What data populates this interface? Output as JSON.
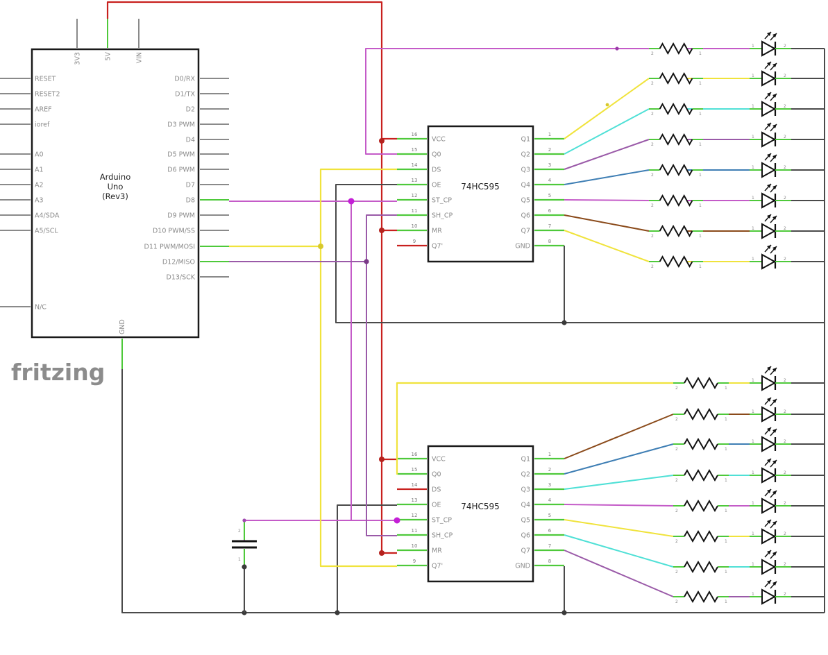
{
  "logo": "fritzing",
  "arduino": {
    "title_lines": [
      "Arduino",
      "Uno",
      "(Rev3)"
    ],
    "top_pins": [
      "3V3",
      "5V",
      "VIN"
    ],
    "left_pins": [
      "RESET",
      "RESET2",
      "AREF",
      "ioref",
      "A0",
      "A1",
      "A2",
      "A3",
      "A4/SDA",
      "A5/SCL",
      "N/C"
    ],
    "right_pins": [
      "D0/RX",
      "D1/TX",
      "D2",
      "D3 PWM",
      "D4",
      "D5 PWM",
      "D6 PWM",
      "D7",
      "D8",
      "D9 PWM",
      "D10 PWM/SS",
      "D11 PWM/MOSI",
      "D12/MISO",
      "D13/SCK"
    ],
    "bottom_pin": "GND"
  },
  "chips": [
    {
      "name": "74HC595",
      "left_pins": [
        {
          "num": "16",
          "label": "VCC"
        },
        {
          "num": "15",
          "label": "Q0"
        },
        {
          "num": "14",
          "label": "DS"
        },
        {
          "num": "13",
          "label": "OE"
        },
        {
          "num": "12",
          "label": "ST_CP"
        },
        {
          "num": "11",
          "label": "SH_CP"
        },
        {
          "num": "10",
          "label": "MR"
        },
        {
          "num": "9",
          "label": "Q7'"
        }
      ],
      "right_pins": [
        {
          "num": "1",
          "label": "Q1"
        },
        {
          "num": "2",
          "label": "Q2"
        },
        {
          "num": "3",
          "label": "Q3"
        },
        {
          "num": "4",
          "label": "Q4"
        },
        {
          "num": "5",
          "label": "Q5"
        },
        {
          "num": "6",
          "label": "Q6"
        },
        {
          "num": "7",
          "label": "Q7"
        },
        {
          "num": "8",
          "label": "GND"
        }
      ]
    },
    {
      "name": "74HC595",
      "left_pins": [
        {
          "num": "16",
          "label": "VCC"
        },
        {
          "num": "15",
          "label": "Q0"
        },
        {
          "num": "14",
          "label": "DS"
        },
        {
          "num": "13",
          "label": "OE"
        },
        {
          "num": "12",
          "label": "ST_CP"
        },
        {
          "num": "11",
          "label": "SH_CP"
        },
        {
          "num": "10",
          "label": "MR"
        },
        {
          "num": "9",
          "label": "Q7'"
        }
      ],
      "right_pins": [
        {
          "num": "1",
          "label": "Q1"
        },
        {
          "num": "2",
          "label": "Q2"
        },
        {
          "num": "3",
          "label": "Q3"
        },
        {
          "num": "4",
          "label": "Q4"
        },
        {
          "num": "5",
          "label": "Q5"
        },
        {
          "num": "6",
          "label": "Q6"
        },
        {
          "num": "7",
          "label": "Q7"
        },
        {
          "num": "8",
          "label": "GND"
        }
      ]
    }
  ],
  "resistor_pins": [
    "2",
    "1"
  ],
  "led_pins": [
    "1",
    "2"
  ],
  "capacitor_pins": [
    "2",
    "1"
  ],
  "colors": {
    "power": "#c8201e",
    "ground": "#4a4a4a",
    "pin_stub": "#4ec93a",
    "pink": "#c45bc8",
    "yellow": "#f0e33c",
    "cyan": "#4fe0d6",
    "purple": "#9a5aa8",
    "blue": "#3e7eb4",
    "brown": "#8a4a1a",
    "junction_pink": "#c41fd6"
  }
}
